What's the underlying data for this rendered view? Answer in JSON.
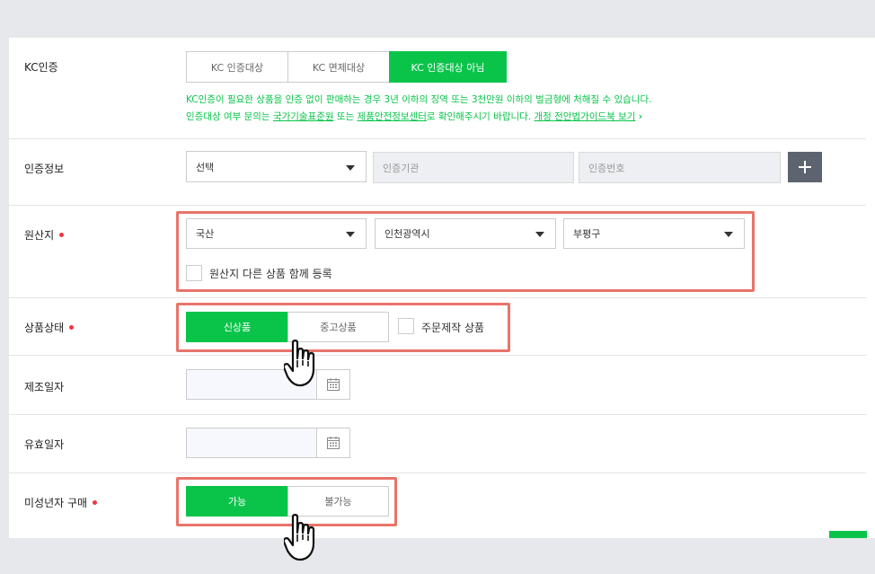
{
  "kc": {
    "label": "KC인증",
    "options": [
      "KC 인증대상",
      "KC 면제대상",
      "KC 인증대상 아님"
    ],
    "selected_index": 2,
    "note_line1": "KC인증이 필요한 상품을 인증 없이 판매하는 경우 3년 이하의 징역 또는 3천만원 이하의 벌금형에 처해질 수 있습니다.",
    "note_line2_a": "인증대상 여부 문의는 ",
    "note_link1": "국가기술표준원",
    "note_line2_b": " 또는 ",
    "note_link2": "제품안전정보센터",
    "note_line2_c": "로 확인해주시기 바랍니다. ",
    "note_link3": "개정 전안법가이드북 보기",
    "note_arrow": "›"
  },
  "cert_info": {
    "label": "인증정보",
    "select_value": "선택",
    "agency_placeholder": "인증기관",
    "number_placeholder": "인증번호"
  },
  "origin": {
    "label": "원산지",
    "select1": "국산",
    "select2": "인천광역시",
    "select3": "부평구",
    "checkbox_label": "원산지 다른 상품 함께 등록"
  },
  "condition": {
    "label": "상품상태",
    "options": [
      "신상품",
      "중고상품"
    ],
    "selected_index": 0,
    "custom_label": "주문제작 상품"
  },
  "manufacture": {
    "label": "제조일자"
  },
  "expiry": {
    "label": "유효일자"
  },
  "minor": {
    "label": "미성년자 구매",
    "options": [
      "가능",
      "불가능"
    ],
    "selected_index": 0
  },
  "colors": {
    "accent": "#0ac44a",
    "highlight": "#e8746a",
    "required": "#f0353d"
  }
}
